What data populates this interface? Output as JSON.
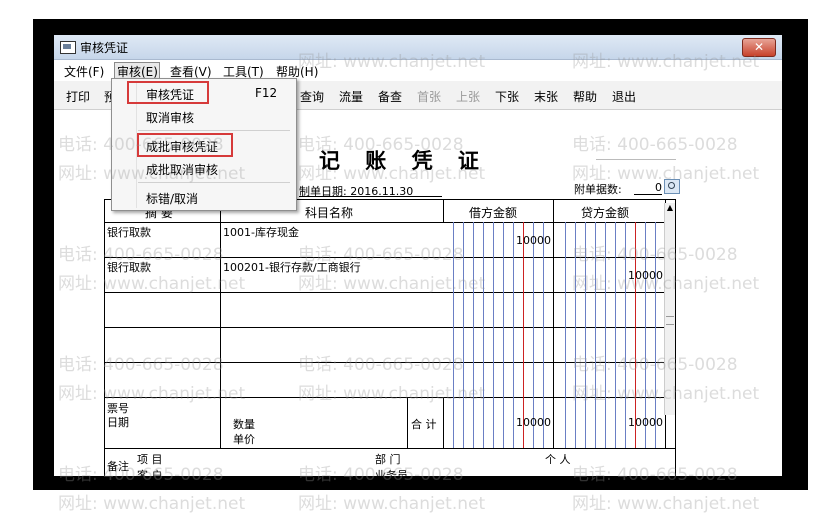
{
  "window": {
    "title": "审核凭证",
    "close_label": "✕"
  },
  "menubar": {
    "items": [
      "文件(F)",
      "审核(E)",
      "查看(V)",
      "工具(T)",
      "帮助(H)"
    ]
  },
  "toolbar": {
    "first": "打印",
    "partial": "预",
    "items": [
      {
        "label": "查询",
        "disabled": false
      },
      {
        "label": "流量",
        "disabled": false
      },
      {
        "label": "备查",
        "disabled": false
      },
      {
        "label": "首张",
        "disabled": true
      },
      {
        "label": "上张",
        "disabled": true
      },
      {
        "label": "下张",
        "disabled": false
      },
      {
        "label": "末张",
        "disabled": false
      },
      {
        "label": "帮助",
        "disabled": false
      },
      {
        "label": "退出",
        "disabled": false
      }
    ]
  },
  "dropdown": {
    "items": [
      {
        "label": "审核凭证",
        "shortcut": "F12"
      },
      {
        "label": "取消审核",
        "shortcut": ""
      },
      {
        "label": "成批审核凭证",
        "shortcut": ""
      },
      {
        "label": "成批取消审核",
        "shortcut": ""
      },
      {
        "label": "标错/取消",
        "shortcut": ""
      }
    ]
  },
  "voucher": {
    "title": "记 账 凭 证",
    "date_label": "制单日期:",
    "date": "2016.11.30",
    "attachments_label": "附单据数:",
    "attachments": "0",
    "headers": {
      "summary": "摘 要",
      "account": "科目名称",
      "debit": "借方金额",
      "credit": "贷方金额"
    },
    "rows": [
      {
        "summary": "银行取款",
        "account": "1001-库存现金",
        "debit": "10000",
        "credit": ""
      },
      {
        "summary": "银行取款",
        "account": "100201-银行存款/工商银行",
        "debit": "",
        "credit": "10000"
      }
    ],
    "footer": {
      "ticket_no": "票号",
      "date": "日期",
      "quantity": "数量",
      "unit_price": "单价",
      "total_label": "合 计",
      "total_debit": "10000",
      "total_credit": "10000",
      "remark": "备注",
      "project": "项 目",
      "customer": "客 户",
      "department": "部 门",
      "person": "个 人",
      "business_clerk": "业务员"
    }
  },
  "watermark": {
    "phone": "电话: 400-665-0028",
    "site": "网址: www.chanjet.net"
  },
  "colors": {
    "highlight": "#d63a3a",
    "red_line": "#cc2222",
    "blue_line": "#6a7fc4"
  }
}
